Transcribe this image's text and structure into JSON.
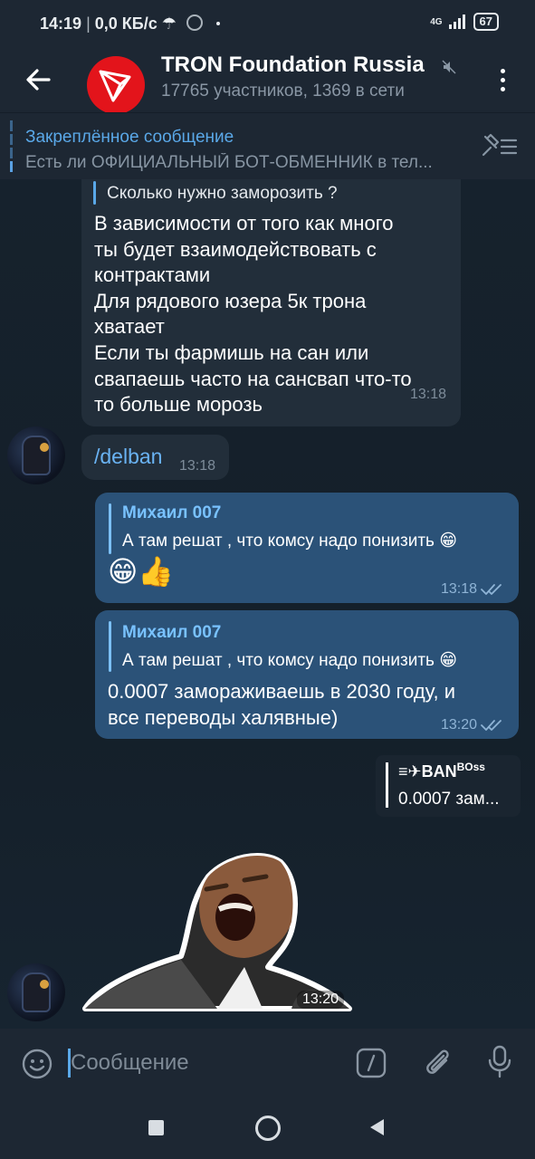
{
  "status_bar": {
    "time": "14:19",
    "speed": "0,0 КБ/с",
    "network": "4G",
    "battery": "67"
  },
  "header": {
    "title": "TRON Foundation Russia",
    "subtitle": "17765 участников, 1369 в сети",
    "avatar_color": "#e3141b"
  },
  "pinned": {
    "title": "Закреплённое сообщение",
    "text": "Есть ли ОФИЦИАЛЬНЫЙ БОТ-ОБМЕННИК в тел..."
  },
  "messages": {
    "m1": {
      "reply_text": "Сколько нужно заморозить ?",
      "lines": [
        "В зависимости от того как много",
        "ты будет взаимодействовать с",
        "контрактами",
        "Для рядового юзера 5к трона",
        "хватает",
        "Если ты фармишь на сан или",
        "свапаешь часто на сансвап что-то",
        "то больше морозь"
      ],
      "time": "13:18"
    },
    "m2": {
      "text": "/delban",
      "time": "13:18"
    },
    "m3": {
      "reply_name": "Михаил 007",
      "reply_text": "А там решат , что комсу надо понизить 😁",
      "text": "😁👍",
      "time": "13:18"
    },
    "m4": {
      "reply_name": "Михаил 007",
      "reply_text": "А там решат , что комсу надо понизить 😁",
      "lines": [
        "0.0007 замораживаешь в 2030 году, и",
        "все переводы халявные)"
      ],
      "time": "13:20"
    },
    "m5": {
      "name": "BAN",
      "name_sup": "BOss",
      "text": "0.0007 зам..."
    },
    "m6": {
      "time": "13:20"
    }
  },
  "input": {
    "placeholder": "Сообщение"
  },
  "colors": {
    "bubble_in": "#222e3a",
    "bubble_out": "#2b5278",
    "accent": "#5aa8e8"
  }
}
